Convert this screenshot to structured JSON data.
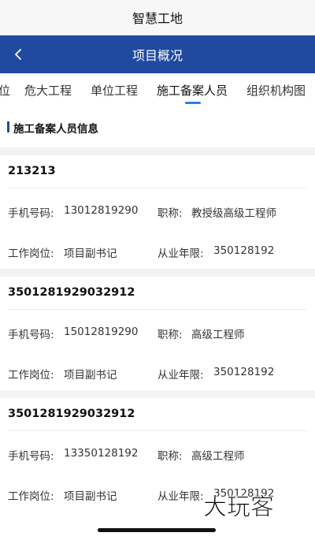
{
  "app": {
    "title": "智慧工地"
  },
  "nav": {
    "title": "项目概况",
    "back_icon": "chevron-left-icon"
  },
  "tabs": [
    {
      "label": "位",
      "active": false
    },
    {
      "label": "危大工程",
      "active": false
    },
    {
      "label": "单位工程",
      "active": false
    },
    {
      "label": "施工备案人员",
      "active": true
    },
    {
      "label": "组织机构图",
      "active": false
    }
  ],
  "section": {
    "title": "施工备案人员信息"
  },
  "field_labels": {
    "phone": "手机号码:",
    "title": "职称:",
    "position": "工作岗位:",
    "years": "从业年限:"
  },
  "personnel": [
    {
      "name": "213213",
      "phone": "13012819290",
      "title": "教授级高级工程师",
      "position": "项目副书记",
      "years": "350128192"
    },
    {
      "name": "3501281929032912",
      "phone": "15012819290",
      "title": "高级工程师",
      "position": "项目副书记",
      "years": "350128192"
    },
    {
      "name": "3501281929032912",
      "phone": "13350128192",
      "title": "高级工程师",
      "position": "项目副书记",
      "years": "350128192"
    }
  ],
  "watermark": {
    "text": "大玩客"
  },
  "colors": {
    "nav_bg": "#1f4aa0",
    "tab_underline": "#2f7ce8",
    "page_bg": "#f2f3f5"
  }
}
